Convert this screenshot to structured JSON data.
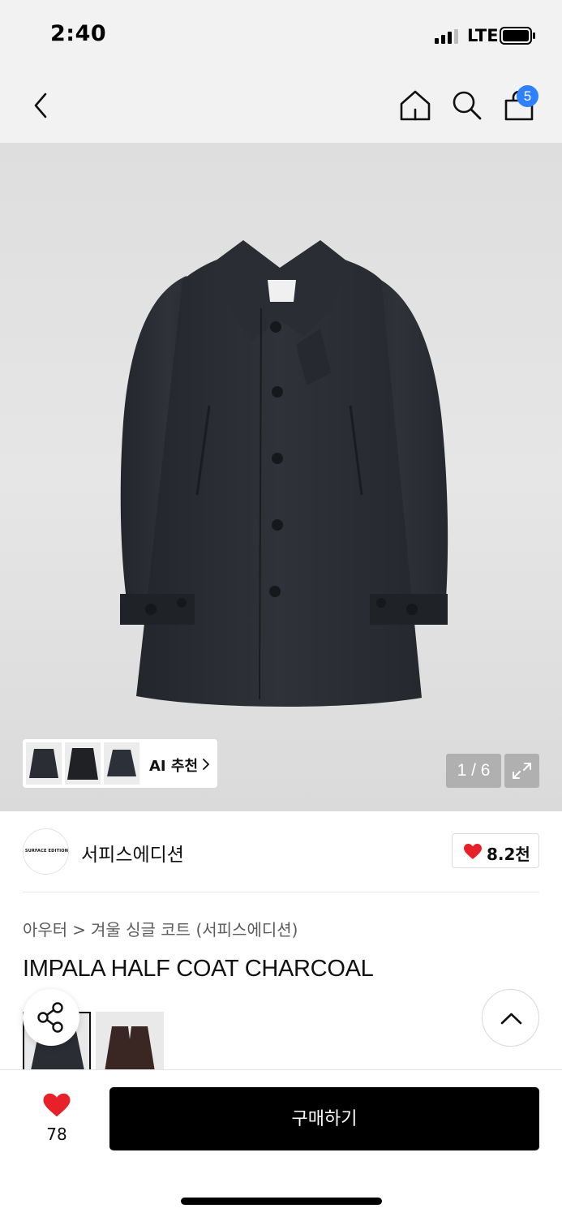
{
  "status_bar": {
    "time": "2:40",
    "network": "LTE"
  },
  "nav": {
    "back_icon": "chevron-left-icon",
    "home_icon": "home-icon",
    "search_icon": "search-icon",
    "cart_icon": "shopping-bag-icon",
    "cart_count": "5",
    "badge_color": "#2f80ff"
  },
  "gallery": {
    "ai_label": "AI 추천",
    "ai_thumbnails": [
      "jacket-thumb-1",
      "jacket-thumb-2",
      "jacket-thumb-3"
    ],
    "counter": "1 / 6",
    "expand_icon": "expand-icon"
  },
  "brand": {
    "logo_text": "SURFACE EDITION",
    "name": "서피스에디션",
    "like_count": "8.2천",
    "like_icon": "heart-icon",
    "heart_color": "#e8202a"
  },
  "product": {
    "breadcrumb": [
      "아우터",
      "겨울 싱글 코트 (서피스에디션)"
    ],
    "title": "IMPALA HALF COAT CHARCOAL",
    "swatches": [
      "charcoal",
      "brown"
    ]
  },
  "floating": {
    "share_icon": "share-icon",
    "top_icon": "chevron-up-icon"
  },
  "bottom_bar": {
    "wish_icon": "heart-icon",
    "wish_count": "78",
    "buy_label": "구매하기"
  }
}
